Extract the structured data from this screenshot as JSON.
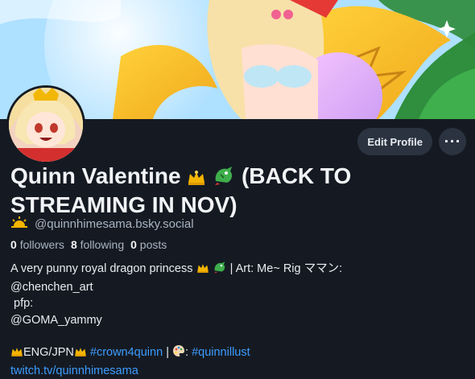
{
  "profile": {
    "display_name_line1": "Quinn Valentine",
    "display_name_line1_suffix": "(BACK TO",
    "display_name_line2": "STREAMING IN NOV)",
    "handle": "@quinnhimesama.bsky.social",
    "stats": {
      "followers_count": "0",
      "followers_label": "followers",
      "following_count": "8",
      "following_label": "following",
      "posts_count": "0",
      "posts_label": "posts"
    }
  },
  "actions": {
    "edit_profile_label": "Edit Profile",
    "more_label": "···"
  },
  "bio": {
    "line1_text": "A very punny royal dragon princess",
    "line1_after": "| Art: Me~ Rig ママン:",
    "line2": "@chenchen_art",
    "line3": " pfp:",
    "line4": "@GOMA_yammy",
    "line6_eng": "ENG/JPN",
    "line6_tag1": "#crown4quinn",
    "line6_sep": "|",
    "line6_colon": ":",
    "line6_tag2": "#quinnillust",
    "line7_link": "twitch.tv/quinnhimesama"
  },
  "icons": {
    "crown": "crown-icon",
    "dragon": "dragon-icon",
    "sunrise": "sunrise-icon",
    "palette": "palette-icon"
  },
  "colors": {
    "background": "#151a22",
    "button_bg": "#2b3340",
    "link": "#3d9cff",
    "muted": "#a9b4c2"
  }
}
